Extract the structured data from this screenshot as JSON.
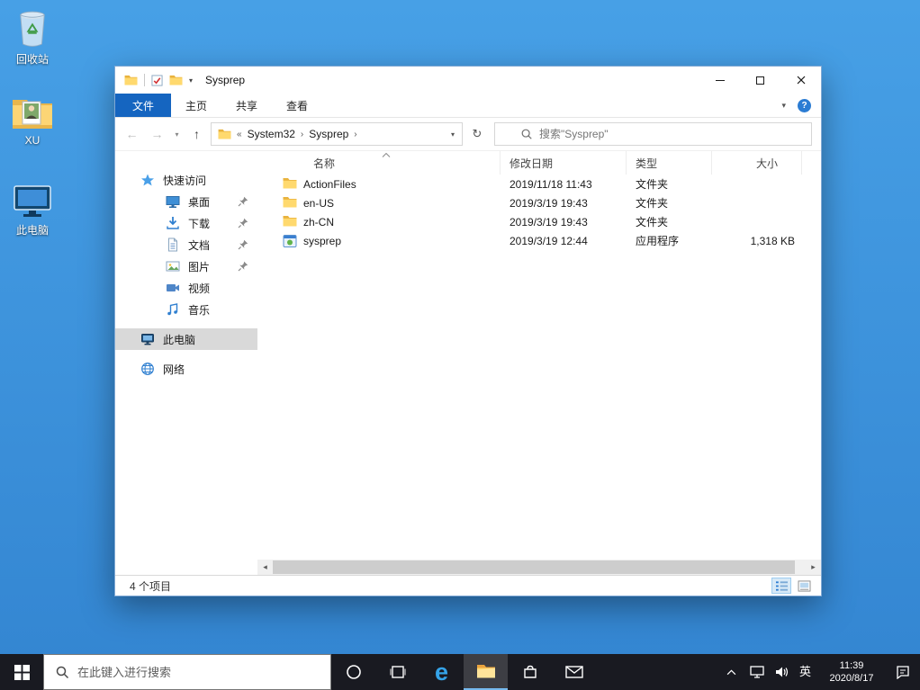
{
  "theme": {
    "desktop_blue": "#3d91dc",
    "taskbar_dark": "#191a21",
    "accent_blue": "#1565c0",
    "folder_yellow": "#ffd56a",
    "selection_gray": "#d9d9d9"
  },
  "desktop": {
    "icons": [
      {
        "label": "回收站"
      },
      {
        "label": "XU"
      },
      {
        "label": "此电脑"
      }
    ]
  },
  "explorer": {
    "title": "Sysprep",
    "ribbon": {
      "tabs": [
        {
          "label": "文件"
        },
        {
          "label": "主页"
        },
        {
          "label": "共享"
        },
        {
          "label": "查看"
        }
      ]
    },
    "address": {
      "overflow": "«",
      "crumbs": [
        "System32",
        "Sysprep"
      ],
      "search_placeholder": "搜索\"Sysprep\""
    },
    "sidebar": {
      "items": [
        {
          "label": "快速访问"
        },
        {
          "label": "桌面"
        },
        {
          "label": "下载"
        },
        {
          "label": "文档"
        },
        {
          "label": "图片"
        },
        {
          "label": "视频"
        },
        {
          "label": "音乐"
        },
        {
          "label": "此电脑"
        },
        {
          "label": "网络"
        }
      ]
    },
    "list": {
      "columns": [
        "名称",
        "修改日期",
        "类型",
        "大小"
      ],
      "rows": [
        {
          "name": "ActionFiles",
          "date": "2019/11/18 11:43",
          "type": "文件夹",
          "size": ""
        },
        {
          "name": "en-US",
          "date": "2019/3/19 19:43",
          "type": "文件夹",
          "size": ""
        },
        {
          "name": "zh-CN",
          "date": "2019/3/19 19:43",
          "type": "文件夹",
          "size": ""
        },
        {
          "name": "sysprep",
          "date": "2019/3/19 12:44",
          "type": "应用程序",
          "size": "1,318 KB"
        }
      ]
    },
    "status": {
      "count": "4 个项目"
    }
  },
  "taskbar": {
    "search_placeholder": "在此键入进行搜索",
    "ime": "英",
    "clock": {
      "time": "11:39",
      "date": "2020/8/17"
    }
  },
  "glyphs": {
    "back": "←",
    "forward": "→",
    "up": "↑",
    "refresh": "↻",
    "dropdown": "▾",
    "crumb_sep": "›",
    "ribbon_collapse": "▾",
    "help": "?",
    "scroll_left": "◂",
    "scroll_right": "▸",
    "edge": "e"
  }
}
